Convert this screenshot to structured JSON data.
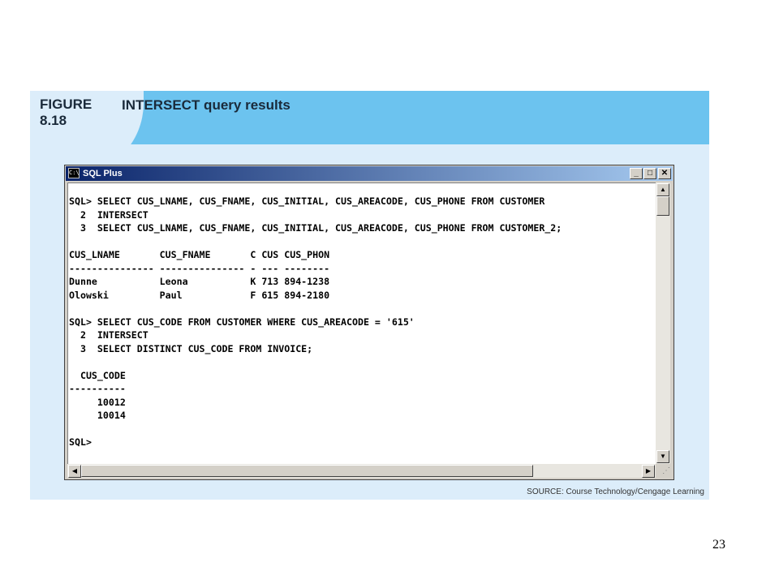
{
  "figure": {
    "label_word": "FIGURE",
    "label_number": "8.18",
    "title": "INTERSECT query results",
    "source": "SOURCE: Course Technology/Cengage Learning"
  },
  "window": {
    "title": "SQL Plus",
    "icon_text": "C:\\",
    "minimize_symbol": "_",
    "maximize_symbol": "□",
    "close_symbol": "✕"
  },
  "console": {
    "lines": [
      "SQL> SELECT CUS_LNAME, CUS_FNAME, CUS_INITIAL, CUS_AREACODE, CUS_PHONE FROM CUSTOMER",
      "  2  INTERSECT",
      "  3  SELECT CUS_LNAME, CUS_FNAME, CUS_INITIAL, CUS_AREACODE, CUS_PHONE FROM CUSTOMER_2;",
      "",
      "CUS_LNAME       CUS_FNAME       C CUS CUS_PHON",
      "--------------- --------------- - --- --------",
      "Dunne           Leona           K 713 894-1238",
      "Olowski         Paul            F 615 894-2180",
      "",
      "SQL> SELECT CUS_CODE FROM CUSTOMER WHERE CUS_AREACODE = '615'",
      "  2  INTERSECT",
      "  3  SELECT DISTINCT CUS_CODE FROM INVOICE;",
      "",
      "  CUS_CODE",
      "----------",
      "     10012",
      "     10014",
      "",
      "SQL>"
    ]
  },
  "scrollbars": {
    "up_arrow": "▲",
    "down_arrow": "▼",
    "left_arrow": "◀",
    "right_arrow": "▶",
    "vertical_position": 0.0,
    "horizontal_position": 0.0
  },
  "page": {
    "number": "23"
  }
}
